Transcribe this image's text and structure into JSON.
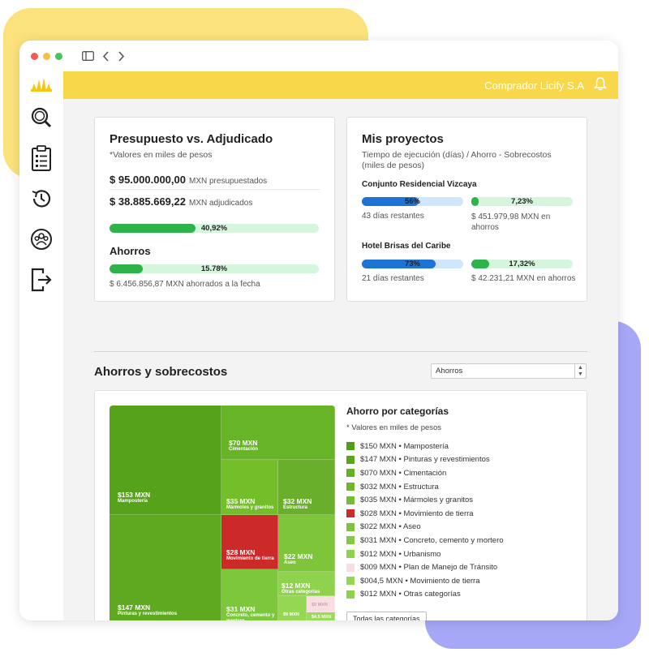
{
  "header": {
    "company": "Comprador Licify S.A"
  },
  "budget": {
    "title": "Presupuesto vs. Adjudicado",
    "note": "*Valores en miles de pesos",
    "budgeted_amount": "$ 95.000.000,00",
    "budgeted_label": "MXN presupuestados",
    "awarded_amount": "$ 38.885.669,22",
    "awarded_label": "MXN adjudicados",
    "awarded_pct_label": "40,92%",
    "awarded_pct": 40.92,
    "savings_title": "Ahorros",
    "savings_pct_label": "15.78%",
    "savings_pct": 15.78,
    "savings_text": "$ 6.456.856,87 MXN ahorrados a la fecha"
  },
  "projects": {
    "title": "Mis proyectos",
    "note": "Tiempo de ejecución (días) / Ahorro - Sobrecostos  (miles de pesos)",
    "items": [
      {
        "name": "Conjunto Residencial Vizcaya",
        "time_label": "56%",
        "time_pct": 56,
        "days": "43 días restantes",
        "saving_label": "7,23%",
        "saving_pct": 7.23,
        "saving_text": "$ 451.979,98 MXN en ahorros"
      },
      {
        "name": "Hotel Brisas del Caribe",
        "time_label": "73%",
        "time_pct": 73,
        "days": "21 días restantes",
        "saving_label": "17,32%",
        "saving_pct": 17.32,
        "saving_text": "$ 42.231,21 MXN en ahorros"
      }
    ]
  },
  "savings_section": {
    "title": "Ahorros y sobrecostos",
    "select_value": "Ahorros",
    "legend_title": "Ahorro por categorías",
    "legend_note": "* Valores en miles de pesos",
    "button": "Todas las categorías",
    "treemap": [
      {
        "value": "$153 MXN",
        "name": "Mampostería",
        "color": "#56a31b"
      },
      {
        "value": "$147 MXN",
        "name": "Pinturas y revestimientos",
        "color": "#5ea91f"
      },
      {
        "value": "$70 MXN",
        "name": "Cimentación",
        "color": "#67b526"
      },
      {
        "value": "$35 MXN",
        "name": "Mármoles y granitos",
        "color": "#74be2a"
      },
      {
        "value": "$32 MXN",
        "name": "Estructura",
        "color": "#6aaf2c"
      },
      {
        "value": "$28 MXN",
        "name": "Movimiento de tierra",
        "color": "#cc2a29"
      },
      {
        "value": "$22 MXN",
        "name": "Aseo",
        "color": "#7ec53a"
      },
      {
        "value": "$31 MXN",
        "name": "Concreto, cemento y mortero",
        "color": "#7cc83a"
      },
      {
        "value": "$12 MXN",
        "name": "Otras categorías",
        "color": "#8fd24d"
      },
      {
        "value": "$9 MXN",
        "name": "",
        "color": "#95d653"
      },
      {
        "value": "$4,5 MXN",
        "name": "",
        "color": "#9cd95c"
      },
      {
        "value": "$9 MXN",
        "name": "",
        "color": "#f9dde0"
      }
    ],
    "legend": [
      {
        "label": "$150 MXN • Mampostería",
        "color": "#4f9e16"
      },
      {
        "label": "$147 MXN • Pinturas y revestimientos",
        "color": "#59a51b"
      },
      {
        "label": "$070 MXN • Cimentación",
        "color": "#62b123"
      },
      {
        "label": "$032 MXN • Estructura",
        "color": "#6cb82a"
      },
      {
        "label": "$035 MXN • Mármoles y granitos",
        "color": "#74bf2f"
      },
      {
        "label": "$028 MXN • Movimiento de tierra",
        "color": "#cc2a29"
      },
      {
        "label": "$022 MXN • Aseo",
        "color": "#7ec53a"
      },
      {
        "label": "$031 MXN • Concreto, cemento y mortero",
        "color": "#83ca40"
      },
      {
        "label": "$012 MXN • Urbanismo",
        "color": "#8fd24d"
      },
      {
        "label": "$009 MXN • Plan de Manejo de Tránsito",
        "color": "#f9dde0"
      },
      {
        "label": "$004,5 MXN • Movimiento de tierra",
        "color": "#95d653"
      },
      {
        "label": "$012 MXN • Otras categorías",
        "color": "#8fd24d"
      }
    ]
  }
}
